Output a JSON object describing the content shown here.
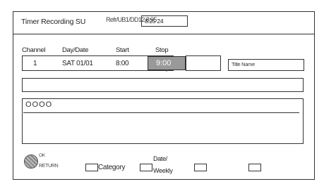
{
  "header": {
    "title": "Timer Recording SU",
    "date_overlay": "Refr/UB1/DD12 8:95",
    "date_box_value": "8:25 24"
  },
  "table": {
    "headers": {
      "channel": "Channel",
      "day_date": "Day/Date",
      "start": "Start",
      "stop": "Stop"
    },
    "row": {
      "channel": "1",
      "day_date": "SAT 01/01",
      "start": "8:00",
      "stop": "9:00"
    },
    "title_name_placeholder": "Title Name"
  },
  "panel": {
    "circles": "OOOO"
  },
  "footer": {
    "ok_label": "OK",
    "return_label": "RETURN",
    "category_label": "Category",
    "date_weekly_line1": "Date/",
    "date_weekly_line2": "Weekly"
  }
}
